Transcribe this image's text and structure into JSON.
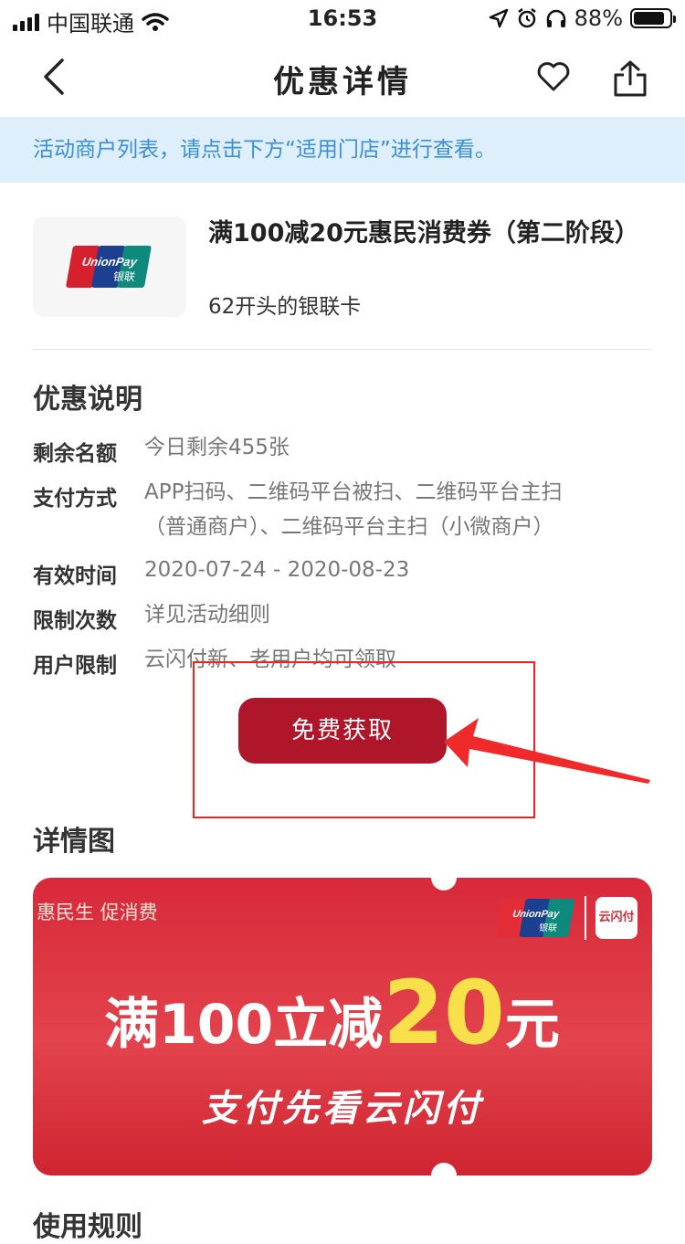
{
  "status": {
    "carrier": "中国联通",
    "time": "16:53",
    "battery_text": "88%",
    "battery_level": 0.88
  },
  "nav": {
    "title": "优惠详情",
    "icons": [
      "chevron-left-icon",
      "heart-icon",
      "share-icon"
    ]
  },
  "notice": "活动商户列表，请点击下方“适用门店”进行查看。",
  "card": {
    "logo_text": "UnionPay 银联",
    "title": "满100减20元惠民消费券（第二阶段）",
    "subtitle": "62开头的银联卡"
  },
  "offer": {
    "section_title": "优惠说明",
    "rows": [
      {
        "label": "剩余名额",
        "value": "今日剩余455张"
      },
      {
        "label": "支付方式",
        "value": "APP扫码、二维码平台被扫、二维码平台主扫",
        "value2": "（普通商户）、二维码平台主扫（小微商户）"
      },
      {
        "label": "有效时间",
        "value": "2020-07-24 - 2020-08-23"
      },
      {
        "label": "限制次数",
        "value": "详见活动细则"
      },
      {
        "label": "用户限制",
        "value": "云闪付新、老用户均可领取"
      }
    ]
  },
  "claim_button": "免费获取",
  "details": {
    "section_title": "详情图",
    "banner": {
      "slogan": "惠民生 促消费",
      "headline_prefix": "满100立减",
      "headline_big": "20",
      "headline_suffix": "元",
      "tagline": "支付先看云闪付",
      "unionpay_logo": "UnionPay 银联",
      "ysf_logo": "云闪付"
    }
  },
  "bottom_section": "使用规则",
  "colors": {
    "accent": "#b0162a",
    "notice_bg": "#deeefb",
    "notice_text": "#3a8fd8",
    "annotation": "#ee2222",
    "banner_red": "#d8293a",
    "banner_yellow": "#f8e04a"
  }
}
